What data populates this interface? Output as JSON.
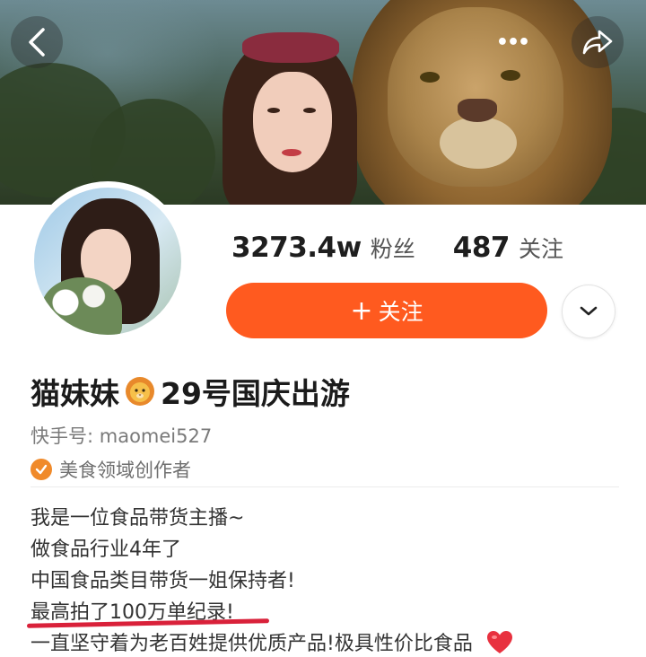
{
  "header": {
    "back_icon": "chevron-left-icon",
    "more_icon": "more-dots-icon",
    "more_label": "•••",
    "share_icon": "share-arrow-icon"
  },
  "profile": {
    "followers_count": "3273.4w",
    "followers_label": "粉丝",
    "following_count": "487",
    "following_label": "关注",
    "follow_button_plus": "+",
    "follow_button_label": "关注",
    "dropdown_icon": "chevron-down-icon",
    "name_part1": "猫妹妹",
    "name_emoji": "lion-emoji",
    "name_part2": "29号国庆出游",
    "kuaishou_id": "快手号: maomei527",
    "badge_icon": "verified-check-icon",
    "badge_text": "美食领域创作者"
  },
  "bio": {
    "lines": [
      "我是一位食品带货主播~",
      "做食品行业4年了",
      "中国食品类目带货一姐保持者!",
      "最高拍了100万单纪录!",
      "一直坚守着为老百姓提供优质产品!极具性价比食品"
    ],
    "heart_icon": "red-heart-icon"
  },
  "colors": {
    "follow_button": "#ff5a1f",
    "badge": "#f08a2a",
    "underline": "#d9213a",
    "heart": "#e8313f"
  }
}
